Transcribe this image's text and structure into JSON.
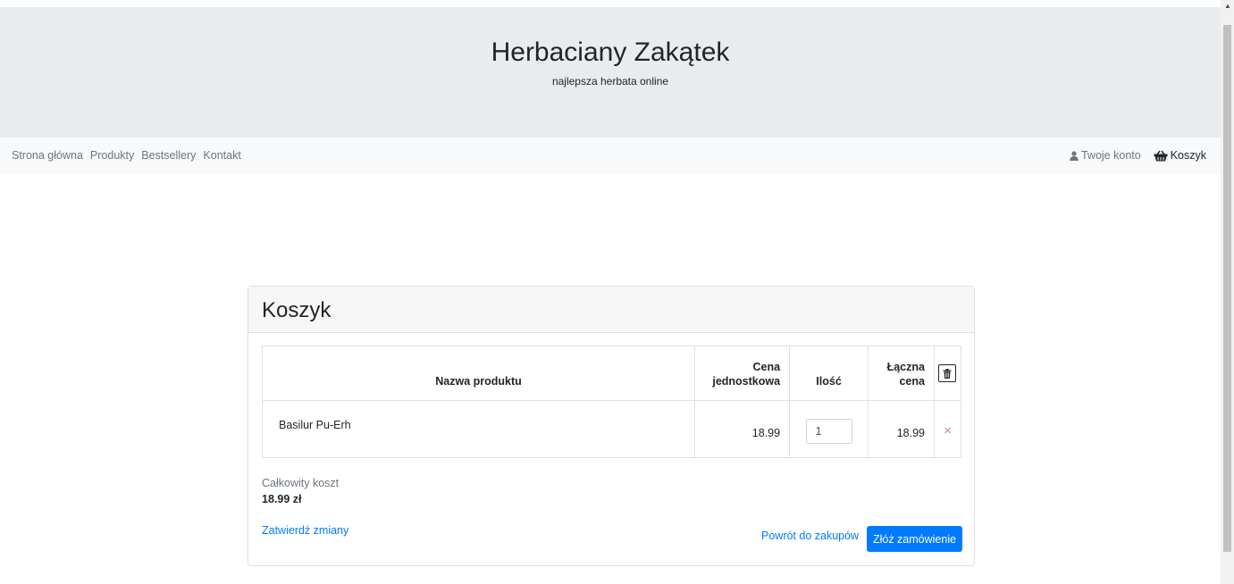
{
  "header": {
    "title": "Herbaciany Zakątek",
    "subtitle": "najlepsza herbata online"
  },
  "nav": {
    "left": [
      "Strona główna",
      "Produkty",
      "Bestsellery",
      "Kontakt"
    ],
    "account": "Twoje konto",
    "cart": "Koszyk"
  },
  "cart": {
    "title": "Koszyk",
    "columns": {
      "name": "Nazwa produktu",
      "unit_price_line1": "Cena",
      "unit_price_line2": "jednostkowa",
      "qty": "Ilość",
      "total_line1": "Łączna",
      "total_line2": "cena"
    },
    "items": [
      {
        "name": "Basilur Pu-Erh",
        "unit_price": "18.99",
        "qty": "1",
        "total": "18.99",
        "remove": "×"
      }
    ],
    "summary_label": "Całkowity koszt",
    "summary_value": "18.99 zł",
    "confirm_label": "Zatwierdź zmiany",
    "back_label": "Powrót do zakupów",
    "order_label": "Złóż zamówienie"
  },
  "colors": {
    "accent": "#007bff",
    "hero_bg": "#e9ecef",
    "nav_bg": "#f8f9fa",
    "remove": "#e08080"
  },
  "icons": {
    "account": "user-icon",
    "cart": "basket-icon",
    "trash": "trash-icon",
    "scroll_up": "chevron-up-icon"
  }
}
